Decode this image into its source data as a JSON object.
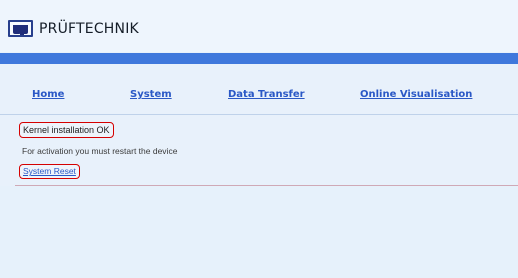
{
  "header": {
    "brand": "PRÜFTECHNIK",
    "logo_icon": "prueftechnik-logo-icon"
  },
  "nav": {
    "items": [
      {
        "label": "Home"
      },
      {
        "label": "System"
      },
      {
        "label": "Data Transfer"
      },
      {
        "label": "Online Visualisation"
      }
    ]
  },
  "main": {
    "status_text": "Kernel installation OK",
    "message": "For activation you must restart the device",
    "reset_link": "System Reset"
  },
  "colors": {
    "background": "#e8f1fb",
    "header_band": "#3f78dc",
    "link": "#2a58c6",
    "highlight_border": "#d50000"
  }
}
